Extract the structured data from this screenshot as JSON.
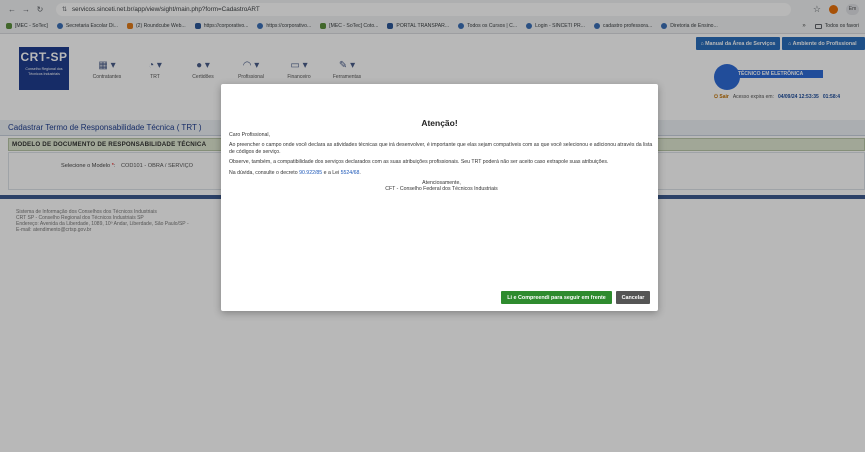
{
  "browser": {
    "url": "servicos.sinceti.net.br/app/view/sight/main.php?form=CadastroART",
    "profile_label": "Em",
    "bookmarks": [
      "[MEC - SoTec]",
      "Secretaria Escolar Di...",
      "(2) Roundcube Web...",
      "https://corporativo...",
      "https://corporativo...",
      "[MEC - SoTec] Coto...",
      "PORTAL TRANSPAR...",
      "Todos os Cursos | C...",
      "Login - SINCETI PR...",
      "cadastro professora...",
      "Diretoria de Ensino..."
    ],
    "bookmarks_overflow": "»",
    "all_bookmarks": "Todos os favori"
  },
  "header": {
    "logo_title": "CRT-SP",
    "logo_subtitle": "Conselho Regional dos Técnicos Industriais",
    "menu": [
      {
        "label": "Contratantes",
        "icon": "building-icon"
      },
      {
        "label": "TRT",
        "icon": "document-icon"
      },
      {
        "label": "Certidões",
        "icon": "certificate-icon"
      },
      {
        "label": "Profissional",
        "icon": "user-icon"
      },
      {
        "label": "Financeiro",
        "icon": "money-icon"
      },
      {
        "label": "Ferramentas",
        "icon": "tools-icon"
      }
    ],
    "btn_manual": "Manual da Área de Serviços",
    "btn_ambiente": "Ambiente do Profissional",
    "user_role": "TÉCNICO EM ELETRÔNICA",
    "sair": "Sair",
    "session_text": "Acesso expira em:",
    "session_date": "04/09/24 12:53:35",
    "session_extra": "01:58:4"
  },
  "main": {
    "title": "Cadastrar Termo de Responsabilidade Técnica ( TRT )",
    "section": "MODELO DE DOCUMENTO DE RESPONSABILIDADE TÉCNICA",
    "select_label": "Selecione o Modelo",
    "select_req": "*",
    "select_value": "COD101 - OBRA / SERVIÇO"
  },
  "footer": {
    "line1": "Sistema de Informação dos Conselhos dos Técnicos Industriais",
    "line2": "CRT SP - Conselho Regional dos Técnicos Industriais SP",
    "line3": "Endereço: Avenida da Liberdade, 1089, 10º Andar, Liberdade, São Paulo/SP - ",
    "line4": "E-mail: atendimento@crtsp.gov.br"
  },
  "modal": {
    "title": "Atenção!",
    "greeting": "Caro Profissional,",
    "para1": "Ao preencher o campo onde você declara as atividades técnicas que irá desenvolver, é importante que elas sejam compatíveis com as que você selecionou e adicionou através da lista de códigos de serviço.",
    "para2": "Observe, também, a compatibilidade dos serviços declarados com as suas atribuições profissionais. Seu TRT poderá não ser aceito caso extrapole suas atribuições.",
    "para3_prefix": "Na dúvida, consulte o decreto",
    "decreto_link": "90.922/85",
    "para3_mid": "e a Lei",
    "lei_link": "5524/68",
    "para3_suffix": ".",
    "sign1": "Atenciosamente,",
    "sign2": "CFT - Conselho Federal dos Técnicos Industriais",
    "btn_ok": "Li e Compreendi para seguir em frente",
    "btn_cancel": "Cancelar"
  }
}
